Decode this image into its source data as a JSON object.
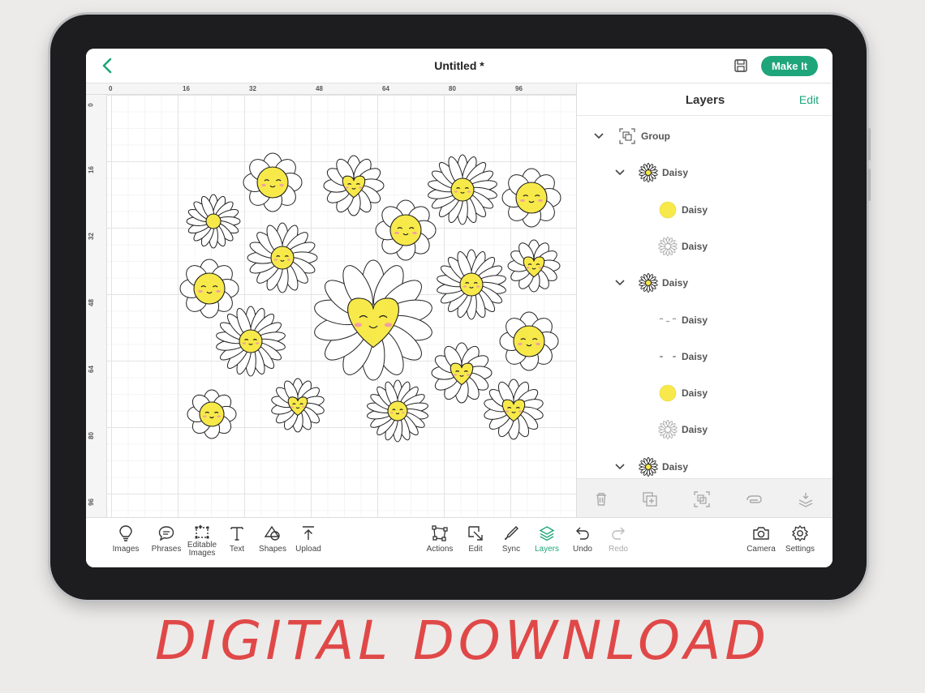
{
  "app": {
    "title": "Untitled *",
    "make_it_label": "Make It",
    "accent_color": "#1fa57a"
  },
  "rulers": {
    "top": [
      "0",
      "16",
      "32",
      "48",
      "64",
      "80",
      "96"
    ],
    "left": [
      "0",
      "16",
      "32",
      "48",
      "64",
      "80",
      "96"
    ]
  },
  "layers_panel": {
    "title": "Layers",
    "edit_label": "Edit",
    "items": [
      {
        "label": "Group",
        "level": 0,
        "icon": "group-icon",
        "expanded": true
      },
      {
        "label": "Daisy",
        "level": 1,
        "icon": "daisy-thumbnail-icon",
        "expanded": true
      },
      {
        "label": "Daisy",
        "level": 2,
        "icon": "yellow-circle-thumbnail-icon"
      },
      {
        "label": "Daisy",
        "level": 2,
        "icon": "daisy-outline-thumbnail-icon"
      },
      {
        "label": "Daisy",
        "level": 1,
        "icon": "daisy-thumbnail-icon",
        "expanded": true
      },
      {
        "label": "Daisy",
        "level": 2,
        "icon": "face-eyes-thumbnail-icon"
      },
      {
        "label": "Daisy",
        "level": 2,
        "icon": "face-blush-thumbnail-icon"
      },
      {
        "label": "Daisy",
        "level": 2,
        "icon": "yellow-circle-thumbnail-icon"
      },
      {
        "label": "Daisy",
        "level": 2,
        "icon": "daisy-outline-thumbnail-icon"
      },
      {
        "label": "Daisy",
        "level": 1,
        "icon": "daisy-thumbnail-icon",
        "expanded": true
      }
    ],
    "actions": [
      "trash-icon",
      "duplicate-icon",
      "group-icon",
      "attach-icon",
      "flatten-icon"
    ]
  },
  "toolbar": {
    "left": [
      {
        "label": "Images",
        "icon": "lightbulb-icon"
      },
      {
        "label": "Phrases",
        "icon": "speech-bubble-icon"
      },
      {
        "label": "Editable Images",
        "icon": "editable-images-icon"
      },
      {
        "label": "Text",
        "icon": "text-icon"
      },
      {
        "label": "Shapes",
        "icon": "shapes-icon"
      },
      {
        "label": "Upload",
        "icon": "upload-icon"
      }
    ],
    "center": [
      {
        "label": "Actions",
        "icon": "actions-icon"
      },
      {
        "label": "Edit",
        "icon": "edit-icon"
      },
      {
        "label": "Sync",
        "icon": "sync-icon"
      },
      {
        "label": "Layers",
        "icon": "layers-icon",
        "active": true
      },
      {
        "label": "Undo",
        "icon": "undo-icon"
      },
      {
        "label": "Redo",
        "icon": "redo-icon",
        "disabled": true
      }
    ],
    "right": [
      {
        "label": "Camera",
        "icon": "camera-icon"
      },
      {
        "label": "Settings",
        "icon": "settings-icon"
      }
    ]
  },
  "banner": {
    "text": "DIGITAL DOWNLOAD",
    "color": "#e04848"
  },
  "artwork": {
    "petal_color": "#ffffff",
    "center_color": "#f7e94a",
    "outline_color": "#222222"
  }
}
